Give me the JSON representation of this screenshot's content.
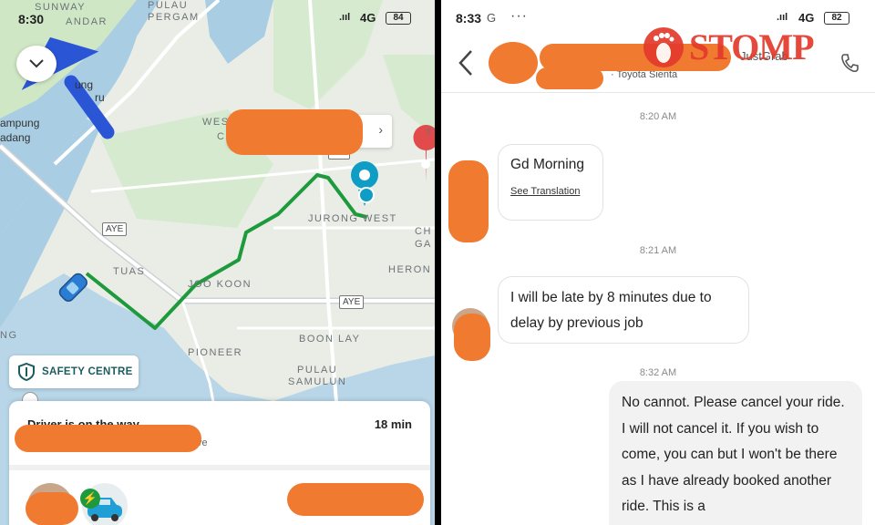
{
  "left_panel": {
    "status": {
      "time": "8:30",
      "signal": ".ııl",
      "network": "4G",
      "battery": "84"
    },
    "map_labels": {
      "sunway": "SUNWAY",
      "kandar": "ANDAR",
      "pulau_pergam": "PULAU\nPERGAM",
      "kampung": "ampung",
      "ladang": "adang",
      "ung": "ung",
      "ru": "ru",
      "west": "WES",
      "c": "C",
      "pie": "PIE",
      "jurong_west": "JURONG WEST",
      "ch": "CH",
      "ga": "GA",
      "aye1": "AYE",
      "tuas": "TUAS",
      "joo_koon": "JOO KOON",
      "heron": "HERON",
      "aye2": "AYE",
      "ng": "NG",
      "boon_lay": "BOON LAY",
      "pioneer": "PIONEER",
      "pulau_samulun": "PULAU\nSAMULUN",
      "t": "T"
    },
    "safety_centre": "SAFETY CENTRE",
    "trip": {
      "status": "Driver is on the way",
      "eta": "18 min",
      "tail": "ve"
    },
    "colors": {
      "route": "#1e9a3c",
      "water": "#a9cde3",
      "land": "#e9ede6",
      "green": "#cfe7c4",
      "brand": "#1b5c5e",
      "pin": "#e24b4b",
      "driver_pin": "#0f9dc6"
    }
  },
  "right_panel": {
    "status": {
      "time": "8:33",
      "g_icon": "G",
      "dots": "···",
      "signal": ".ııl",
      "network": "4G",
      "battery": "82"
    },
    "header": {
      "car_model": "· Toyota Sienta",
      "partial_name": "JustGrab"
    },
    "watermark": "STOMP",
    "messages": [
      {
        "timestamp": "8:20 AM",
        "text": "Gd Morning",
        "action": "See Translation"
      },
      {
        "timestamp": "8:21 AM",
        "text": "I will be late by 8 minutes due to delay by previous job"
      },
      {
        "timestamp": "8:32 AM",
        "text": "No cannot. Please cancel your ride. I will not cancel it. If you wish to come, you can but I won't be there as I have already booked another ride. This is a"
      }
    ]
  }
}
